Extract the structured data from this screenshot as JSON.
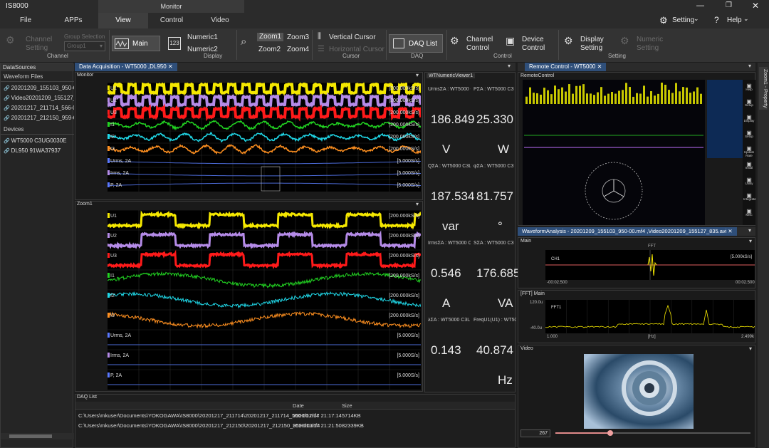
{
  "app": {
    "title": "IS8000",
    "context_tab": "Monitor"
  },
  "menu": {
    "tabs": [
      "File",
      "APPs",
      "View",
      "Control",
      "Video"
    ],
    "active_tab": "View",
    "setting_label": "Setting",
    "help_label": "Help"
  },
  "ribbon": {
    "channel_setting": "Channel\nSetting",
    "group_selection_label": "Group Selection",
    "group_selection_value": "Group1",
    "group_channel": "Channel",
    "main": "Main",
    "numeric1": "Numeric1",
    "numeric2": "Numeric2",
    "group_display": "Display",
    "zoom1": "Zoom1",
    "zoom2": "Zoom2",
    "zoom3": "Zoom3",
    "zoom4": "Zoom4",
    "vertical_cursor": "Vertical Cursor",
    "horizontal_cursor": "Horizontal Cursor",
    "group_cursor": "Cursor",
    "daq_list": "DAQ List",
    "group_daq": "DAQ",
    "channel_control": "Channel\nControl",
    "device_control": "Device\nControl",
    "group_control": "Control",
    "display_setting": "Display\nSetting",
    "numeric_setting": "Numeric\nSetting",
    "group_setting": "Setting"
  },
  "sidebar": {
    "title": "DataSources",
    "waveform_files_label": "Waveform Files",
    "waveform_files": [
      "20201209_155103_950-00.m",
      "Video20201209_155127_835",
      "20201217_211714_566-00.m",
      "20201217_212150_959-00.m"
    ],
    "devices_label": "Devices",
    "devices": [
      "WT5000 C3UG0030E",
      "DL950 91WA37937"
    ]
  },
  "daq_tab": {
    "title": "Data Acquisition - WT5000 ,DL950"
  },
  "monitor": {
    "title": "Monitor",
    "tracks": [
      {
        "label": "U1",
        "rate": "[200.000kS/s]",
        "color": "#f5e800"
      },
      {
        "label": "U2",
        "rate": "[200.000kS/s]",
        "color": "#b58be8"
      },
      {
        "label": "U3",
        "rate": "[200.000kS/s]",
        "color": "#ff1a1a"
      },
      {
        "label": "I1",
        "rate": "[200.000kS/s]",
        "color": "#22d422"
      },
      {
        "label": "I2",
        "rate": "[200.000kS/s]",
        "color": "#20d8e8"
      },
      {
        "label": "I3",
        "rate": "[200.000kS/s]",
        "color": "#ff9020"
      },
      {
        "label": "Urms, 2A",
        "rate": "[5.000S/s]",
        "color": "#5a78ff"
      },
      {
        "label": "Irms, 2A",
        "rate": "[5.000S/s]",
        "color": "#b58be8"
      },
      {
        "label": "P, 2A",
        "rate": "[5.000S/s]",
        "color": "#5a78ff"
      }
    ]
  },
  "zoom1": {
    "title": "Zoom1",
    "tracks": [
      {
        "label": "U1",
        "rate": "[200.000kS/s]",
        "color": "#f5e800"
      },
      {
        "label": "U2",
        "rate": "[200.000kS/s]",
        "color": "#b58be8"
      },
      {
        "label": "U3",
        "rate": "[200.000kS/s]",
        "color": "#ff1a1a"
      },
      {
        "label": "I1",
        "rate": "[200.000kS/s]",
        "color": "#22d422"
      },
      {
        "label": "I2",
        "rate": "[200.000kS/s]",
        "color": "#20d8e8"
      },
      {
        "label": "I3",
        "rate": "[200.000kS/s]",
        "color": "#ff9020"
      },
      {
        "label": "Urms, 2A",
        "rate": "[5.000S/s]",
        "color": "#5a78ff"
      },
      {
        "label": "Irms, 2A",
        "rate": "[5.000S/s]",
        "color": "#b58be8"
      },
      {
        "label": "P, 2A",
        "rate": "[5.000S/s]",
        "color": "#5a78ff"
      }
    ]
  },
  "numeric": {
    "title": "WTNumericViewer1",
    "cells": [
      {
        "label": "UrmsΣA : WT5000 C3",
        "value": "186.849",
        "unit": "V"
      },
      {
        "label": "PΣA : WT5000 C3",
        "value": "25.330",
        "unit": "W"
      },
      {
        "label": "QΣA : WT5000 C3L",
        "value": "187.534",
        "unit": "var"
      },
      {
        "label": "φΣA : WT5000 C3",
        "value": "81.757",
        "unit": "°"
      },
      {
        "label": "IrmsΣA : WT5000 C3",
        "value": "0.546",
        "unit": "A"
      },
      {
        "label": "SΣA : WT5000 C3",
        "value": "176.685",
        "unit": "VA"
      },
      {
        "label": "λΣA : WT5000 C3L",
        "value": "0.143",
        "unit": ""
      },
      {
        "label": "FreqU1(U1) : WT5000",
        "value": "40.874",
        "unit": "Hz"
      }
    ]
  },
  "daq_list": {
    "title": "DAQ List",
    "columns": [
      "",
      "Date",
      "Size"
    ],
    "rows": [
      {
        "path": "C:\\Users\\mkuser\\Documents\\YOKOGAWA\\IS8000\\20201217_211714\\20201217_211714_566-00.mf4",
        "date": "2020/12/17 21:17:14",
        "size": "5714KB"
      },
      {
        "path": "C:\\Users\\mkuser\\Documents\\YOKOGAWA\\IS8000\\20201217_212150\\20201217_212150_959-00.mf4",
        "date": "2020/12/17 21:21:50",
        "size": "82339KB"
      }
    ]
  },
  "remote": {
    "tab_title": "Remote Control - WT5000",
    "panel_title": "RemoteControl",
    "right_buttons": [
      "Help",
      "Setup",
      "Display",
      "Setup",
      "Update Rate",
      "Initial",
      "Utility",
      "Integrate",
      "Misc"
    ]
  },
  "wave_analysis": {
    "tab_title": "WaveformAnalysis - 20201209_155103_950-00.mf4 ,Video20201209_155127_835.avi",
    "main_title": "Main",
    "fft_label": "FFT",
    "ch_label": "CH1",
    "rate": "[5.000kS/s]",
    "t_start": "-00:02.500",
    "t_end": "00:02.500",
    "fft_title": "[FFT] Main",
    "fft_y_top": "120.0u",
    "fft_y_bottom": "-40.0u",
    "fft_series": "FFT1",
    "fft_x_left": "1.000",
    "fft_x_unit": "[Hz]",
    "fft_x_right": "2.499k"
  },
  "video": {
    "title": "Video",
    "frame": "267"
  },
  "side_tabs": {
    "label": "Zoom1 - Property"
  }
}
